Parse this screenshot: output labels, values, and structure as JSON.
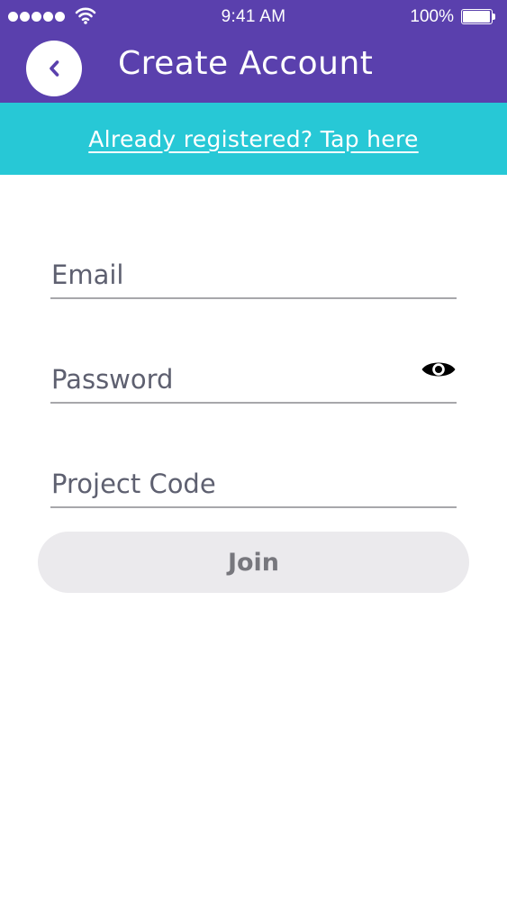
{
  "status_bar": {
    "time": "9:41 AM",
    "battery_percent": "100%",
    "signal_icon": "signal-dots-icon",
    "wifi_icon": "wifi-icon",
    "battery_icon": "battery-icon"
  },
  "header": {
    "title": "Create Account",
    "back_icon": "chevron-left-icon"
  },
  "banner": {
    "link_text": "Already registered? Tap here"
  },
  "form": {
    "email": {
      "placeholder": "Email",
      "value": ""
    },
    "password": {
      "placeholder": "Password",
      "value": "",
      "toggle_icon": "eye-icon"
    },
    "project_code": {
      "placeholder": "Project Code",
      "value": ""
    },
    "join_label": "Join"
  },
  "colors": {
    "header_bg": "#5a40ad",
    "banner_bg": "#27c8d6",
    "button_bg": "#ebeaed",
    "button_text": "#77777d",
    "field_underline": "#a7a7ab",
    "placeholder_text": "#5e6070"
  }
}
